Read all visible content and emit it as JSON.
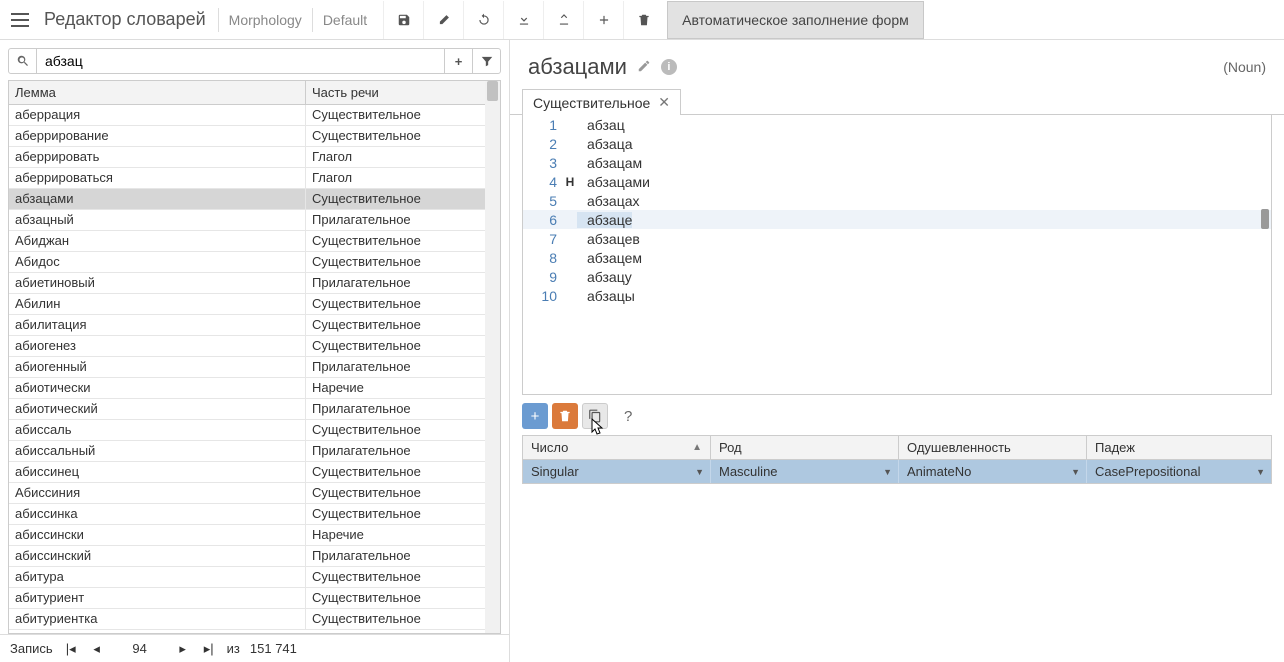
{
  "header": {
    "title": "Редактор словарей",
    "crumbs": [
      "Morphology",
      "Default"
    ],
    "autofill_tab": "Автоматическое заполнение форм"
  },
  "search": {
    "value": "абзац"
  },
  "grid": {
    "columns": [
      "Лемма",
      "Часть речи"
    ],
    "rows": [
      {
        "lemma": "аберрация",
        "pos": "Существительное"
      },
      {
        "lemma": "аберрирование",
        "pos": "Существительное"
      },
      {
        "lemma": "аберрировать",
        "pos": "Глагол"
      },
      {
        "lemma": "аберрироваться",
        "pos": "Глагол"
      },
      {
        "lemma": "абзацами",
        "pos": "Существительное",
        "selected": true
      },
      {
        "lemma": "абзацный",
        "pos": "Прилагательное"
      },
      {
        "lemma": "Абиджан",
        "pos": "Существительное"
      },
      {
        "lemma": "Абидос",
        "pos": "Существительное"
      },
      {
        "lemma": "абиетиновый",
        "pos": "Прилагательное"
      },
      {
        "lemma": "Абилин",
        "pos": "Существительное"
      },
      {
        "lemma": "абилитация",
        "pos": "Существительное"
      },
      {
        "lemma": "абиогенез",
        "pos": "Существительное"
      },
      {
        "lemma": "абиогенный",
        "pos": "Прилагательное"
      },
      {
        "lemma": "абиотически",
        "pos": "Наречие"
      },
      {
        "lemma": "абиотический",
        "pos": "Прилагательное"
      },
      {
        "lemma": "абиссаль",
        "pos": "Существительное"
      },
      {
        "lemma": "абиссальный",
        "pos": "Прилагательное"
      },
      {
        "lemma": "абиссинец",
        "pos": "Существительное"
      },
      {
        "lemma": "Абиссиния",
        "pos": "Существительное"
      },
      {
        "lemma": "абиссинка",
        "pos": "Существительное"
      },
      {
        "lemma": "абиссински",
        "pos": "Наречие"
      },
      {
        "lemma": "абиссинский",
        "pos": "Прилагательное"
      },
      {
        "lemma": "абитура",
        "pos": "Существительное"
      },
      {
        "lemma": "абитуриент",
        "pos": "Существительное"
      },
      {
        "lemma": "абитуриентка",
        "pos": "Существительное"
      }
    ]
  },
  "pager": {
    "label": "Запись",
    "page": "94",
    "total_prefix": "из",
    "total": "151 741"
  },
  "detail": {
    "title": "абзацами",
    "pos_label": "(Noun)",
    "tab_label": "Существительное",
    "forms": [
      {
        "n": 1,
        "word": "абзац"
      },
      {
        "n": 2,
        "word": "абзаца"
      },
      {
        "n": 3,
        "word": "абзацам"
      },
      {
        "n": 4,
        "word": "абзацами",
        "marker": "Н"
      },
      {
        "n": 5,
        "word": "абзацах"
      },
      {
        "n": 6,
        "word": "абзаце",
        "hover": true
      },
      {
        "n": 7,
        "word": "абзацев"
      },
      {
        "n": 8,
        "word": "абзацем"
      },
      {
        "n": 9,
        "word": "абзацу"
      },
      {
        "n": 10,
        "word": "абзацы"
      }
    ],
    "help": "?"
  },
  "attrs": {
    "columns": [
      "Число",
      "Род",
      "Одушевленность",
      "Падеж"
    ],
    "row": {
      "number": "Singular",
      "gender": "Masculine",
      "animacy": "AnimateNo",
      "case": "CasePrepositional"
    }
  }
}
